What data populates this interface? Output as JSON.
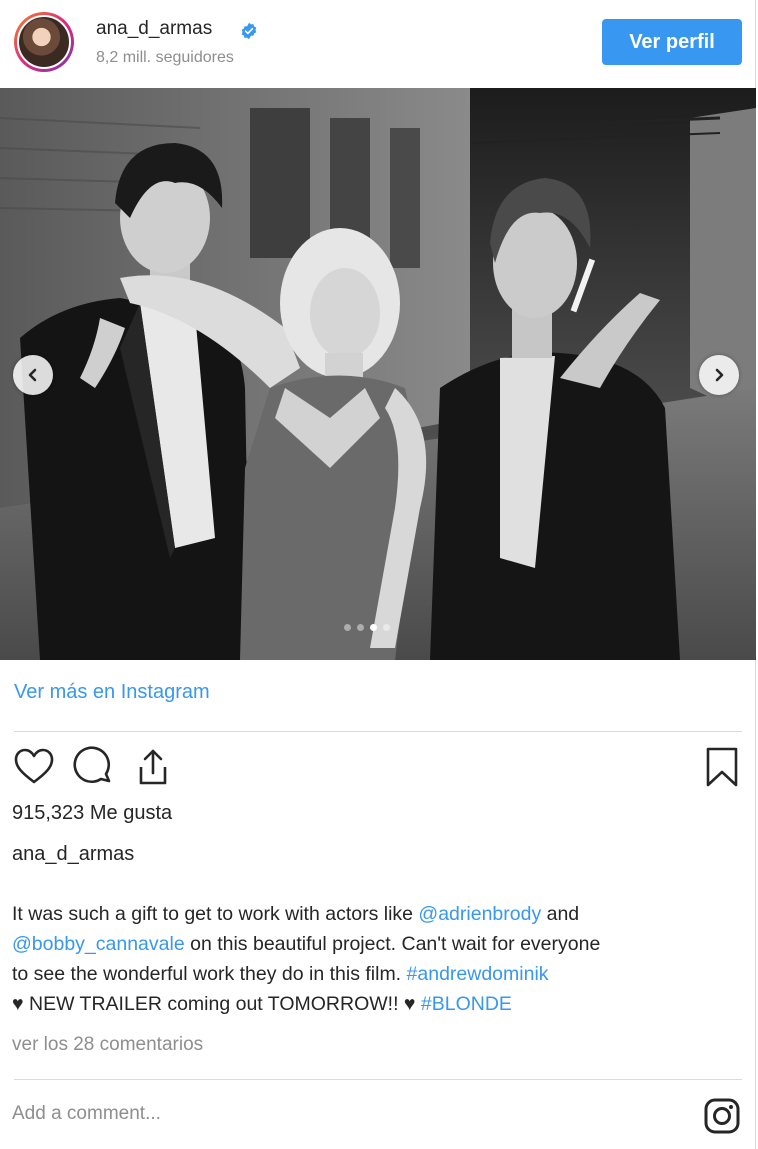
{
  "header": {
    "username": "ana_d_armas",
    "followers": "8,2 mill. seguidores",
    "follow_button": "Ver perfil"
  },
  "carousel": {
    "slide_count": 4,
    "active_slide_index": 2
  },
  "view_more_link": "Ver más en Instagram",
  "likes": "915,323 Me gusta",
  "owner": "ana_d_armas",
  "caption": {
    "line1_text": "It was such a gift to get to work with actors like ",
    "mention1": "@adrienbrody",
    "line1_tail": " and",
    "mention2": "@bobby_cannavale",
    "line2_tail": " on this beautiful project. Can't wait for everyone",
    "line3_text": "to see the wonderful work they do in this film. ",
    "hashtag1": "#andrewdominik",
    "line4_text": "♥ NEW TRAILER coming out TOMORROW!! ♥ ",
    "hashtag2": "#BLONDE"
  },
  "comments_link": "ver los 28 comentarios",
  "comment_placeholder": "Add a comment...",
  "colors": {
    "accent": "#3897f0",
    "text": "#262626",
    "muted": "#8e8e8e",
    "divider": "#dbdbdb"
  },
  "icons": [
    "verified-badge-icon",
    "chevron-left-icon",
    "chevron-right-icon",
    "heart-icon",
    "comment-icon",
    "share-icon",
    "bookmark-icon",
    "instagram-icon"
  ]
}
